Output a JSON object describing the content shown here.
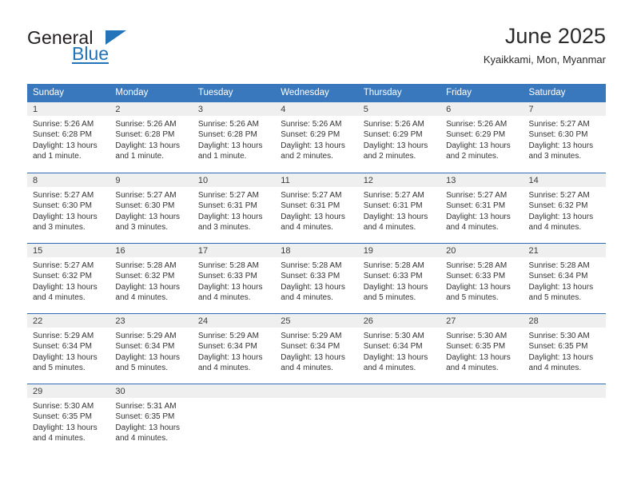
{
  "brand": {
    "word_one": "General",
    "word_two": "Blue",
    "logo_icon": "blue-triangle-icon"
  },
  "header": {
    "title": "June 2025",
    "subtitle": "Kyaikkami, Mon, Myanmar"
  },
  "colors": {
    "header_blue": "#3a78bd",
    "row_divider_blue": "#2e6db4",
    "day_band_gray": "#efefef",
    "brand_blue": "#2273b8",
    "text": "#333333"
  },
  "calendar": {
    "weekday_headers": [
      "Sunday",
      "Monday",
      "Tuesday",
      "Wednesday",
      "Thursday",
      "Friday",
      "Saturday"
    ],
    "weeks": [
      [
        {
          "day": "1",
          "sunrise": "Sunrise: 5:26 AM",
          "sunset": "Sunset: 6:28 PM",
          "daylight_line1": "Daylight: 13 hours",
          "daylight_line2": "and 1 minute."
        },
        {
          "day": "2",
          "sunrise": "Sunrise: 5:26 AM",
          "sunset": "Sunset: 6:28 PM",
          "daylight_line1": "Daylight: 13 hours",
          "daylight_line2": "and 1 minute."
        },
        {
          "day": "3",
          "sunrise": "Sunrise: 5:26 AM",
          "sunset": "Sunset: 6:28 PM",
          "daylight_line1": "Daylight: 13 hours",
          "daylight_line2": "and 1 minute."
        },
        {
          "day": "4",
          "sunrise": "Sunrise: 5:26 AM",
          "sunset": "Sunset: 6:29 PM",
          "daylight_line1": "Daylight: 13 hours",
          "daylight_line2": "and 2 minutes."
        },
        {
          "day": "5",
          "sunrise": "Sunrise: 5:26 AM",
          "sunset": "Sunset: 6:29 PM",
          "daylight_line1": "Daylight: 13 hours",
          "daylight_line2": "and 2 minutes."
        },
        {
          "day": "6",
          "sunrise": "Sunrise: 5:26 AM",
          "sunset": "Sunset: 6:29 PM",
          "daylight_line1": "Daylight: 13 hours",
          "daylight_line2": "and 2 minutes."
        },
        {
          "day": "7",
          "sunrise": "Sunrise: 5:27 AM",
          "sunset": "Sunset: 6:30 PM",
          "daylight_line1": "Daylight: 13 hours",
          "daylight_line2": "and 3 minutes."
        }
      ],
      [
        {
          "day": "8",
          "sunrise": "Sunrise: 5:27 AM",
          "sunset": "Sunset: 6:30 PM",
          "daylight_line1": "Daylight: 13 hours",
          "daylight_line2": "and 3 minutes."
        },
        {
          "day": "9",
          "sunrise": "Sunrise: 5:27 AM",
          "sunset": "Sunset: 6:30 PM",
          "daylight_line1": "Daylight: 13 hours",
          "daylight_line2": "and 3 minutes."
        },
        {
          "day": "10",
          "sunrise": "Sunrise: 5:27 AM",
          "sunset": "Sunset: 6:31 PM",
          "daylight_line1": "Daylight: 13 hours",
          "daylight_line2": "and 3 minutes."
        },
        {
          "day": "11",
          "sunrise": "Sunrise: 5:27 AM",
          "sunset": "Sunset: 6:31 PM",
          "daylight_line1": "Daylight: 13 hours",
          "daylight_line2": "and 4 minutes."
        },
        {
          "day": "12",
          "sunrise": "Sunrise: 5:27 AM",
          "sunset": "Sunset: 6:31 PM",
          "daylight_line1": "Daylight: 13 hours",
          "daylight_line2": "and 4 minutes."
        },
        {
          "day": "13",
          "sunrise": "Sunrise: 5:27 AM",
          "sunset": "Sunset: 6:31 PM",
          "daylight_line1": "Daylight: 13 hours",
          "daylight_line2": "and 4 minutes."
        },
        {
          "day": "14",
          "sunrise": "Sunrise: 5:27 AM",
          "sunset": "Sunset: 6:32 PM",
          "daylight_line1": "Daylight: 13 hours",
          "daylight_line2": "and 4 minutes."
        }
      ],
      [
        {
          "day": "15",
          "sunrise": "Sunrise: 5:27 AM",
          "sunset": "Sunset: 6:32 PM",
          "daylight_line1": "Daylight: 13 hours",
          "daylight_line2": "and 4 minutes."
        },
        {
          "day": "16",
          "sunrise": "Sunrise: 5:28 AM",
          "sunset": "Sunset: 6:32 PM",
          "daylight_line1": "Daylight: 13 hours",
          "daylight_line2": "and 4 minutes."
        },
        {
          "day": "17",
          "sunrise": "Sunrise: 5:28 AM",
          "sunset": "Sunset: 6:33 PM",
          "daylight_line1": "Daylight: 13 hours",
          "daylight_line2": "and 4 minutes."
        },
        {
          "day": "18",
          "sunrise": "Sunrise: 5:28 AM",
          "sunset": "Sunset: 6:33 PM",
          "daylight_line1": "Daylight: 13 hours",
          "daylight_line2": "and 4 minutes."
        },
        {
          "day": "19",
          "sunrise": "Sunrise: 5:28 AM",
          "sunset": "Sunset: 6:33 PM",
          "daylight_line1": "Daylight: 13 hours",
          "daylight_line2": "and 5 minutes."
        },
        {
          "day": "20",
          "sunrise": "Sunrise: 5:28 AM",
          "sunset": "Sunset: 6:33 PM",
          "daylight_line1": "Daylight: 13 hours",
          "daylight_line2": "and 5 minutes."
        },
        {
          "day": "21",
          "sunrise": "Sunrise: 5:28 AM",
          "sunset": "Sunset: 6:34 PM",
          "daylight_line1": "Daylight: 13 hours",
          "daylight_line2": "and 5 minutes."
        }
      ],
      [
        {
          "day": "22",
          "sunrise": "Sunrise: 5:29 AM",
          "sunset": "Sunset: 6:34 PM",
          "daylight_line1": "Daylight: 13 hours",
          "daylight_line2": "and 5 minutes."
        },
        {
          "day": "23",
          "sunrise": "Sunrise: 5:29 AM",
          "sunset": "Sunset: 6:34 PM",
          "daylight_line1": "Daylight: 13 hours",
          "daylight_line2": "and 5 minutes."
        },
        {
          "day": "24",
          "sunrise": "Sunrise: 5:29 AM",
          "sunset": "Sunset: 6:34 PM",
          "daylight_line1": "Daylight: 13 hours",
          "daylight_line2": "and 4 minutes."
        },
        {
          "day": "25",
          "sunrise": "Sunrise: 5:29 AM",
          "sunset": "Sunset: 6:34 PM",
          "daylight_line1": "Daylight: 13 hours",
          "daylight_line2": "and 4 minutes."
        },
        {
          "day": "26",
          "sunrise": "Sunrise: 5:30 AM",
          "sunset": "Sunset: 6:34 PM",
          "daylight_line1": "Daylight: 13 hours",
          "daylight_line2": "and 4 minutes."
        },
        {
          "day": "27",
          "sunrise": "Sunrise: 5:30 AM",
          "sunset": "Sunset: 6:35 PM",
          "daylight_line1": "Daylight: 13 hours",
          "daylight_line2": "and 4 minutes."
        },
        {
          "day": "28",
          "sunrise": "Sunrise: 5:30 AM",
          "sunset": "Sunset: 6:35 PM",
          "daylight_line1": "Daylight: 13 hours",
          "daylight_line2": "and 4 minutes."
        }
      ],
      [
        {
          "day": "29",
          "sunrise": "Sunrise: 5:30 AM",
          "sunset": "Sunset: 6:35 PM",
          "daylight_line1": "Daylight: 13 hours",
          "daylight_line2": "and 4 minutes."
        },
        {
          "day": "30",
          "sunrise": "Sunrise: 5:31 AM",
          "sunset": "Sunset: 6:35 PM",
          "daylight_line1": "Daylight: 13 hours",
          "daylight_line2": "and 4 minutes."
        },
        {
          "day": "",
          "sunrise": "",
          "sunset": "",
          "daylight_line1": "",
          "daylight_line2": ""
        },
        {
          "day": "",
          "sunrise": "",
          "sunset": "",
          "daylight_line1": "",
          "daylight_line2": ""
        },
        {
          "day": "",
          "sunrise": "",
          "sunset": "",
          "daylight_line1": "",
          "daylight_line2": ""
        },
        {
          "day": "",
          "sunrise": "",
          "sunset": "",
          "daylight_line1": "",
          "daylight_line2": ""
        },
        {
          "day": "",
          "sunrise": "",
          "sunset": "",
          "daylight_line1": "",
          "daylight_line2": ""
        }
      ]
    ]
  }
}
